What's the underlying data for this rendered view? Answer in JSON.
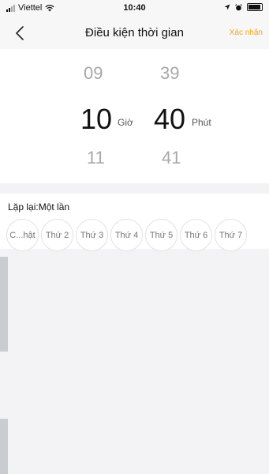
{
  "status_bar": {
    "carrier": "Viettel",
    "time": "10:40"
  },
  "nav": {
    "title": "Điều kiện thời gian",
    "confirm_label": "Xác nhận",
    "back_icon": "chevron-left-icon"
  },
  "picker": {
    "hour": {
      "prev": "09",
      "selected": "10",
      "next": "11",
      "unit": "Giờ"
    },
    "minute": {
      "prev": "39",
      "selected": "40",
      "next": "41",
      "unit": "Phút"
    }
  },
  "repeat": {
    "label": "Lặp lại:Một lần",
    "days": [
      "C...hật",
      "Thứ 2",
      "Thứ 3",
      "Thứ 4",
      "Thứ 5",
      "Thứ 6",
      "Thứ 7"
    ]
  },
  "colors": {
    "accent": "#f6a31a",
    "background": "#f3f3f5",
    "panel": "#ffffff"
  }
}
